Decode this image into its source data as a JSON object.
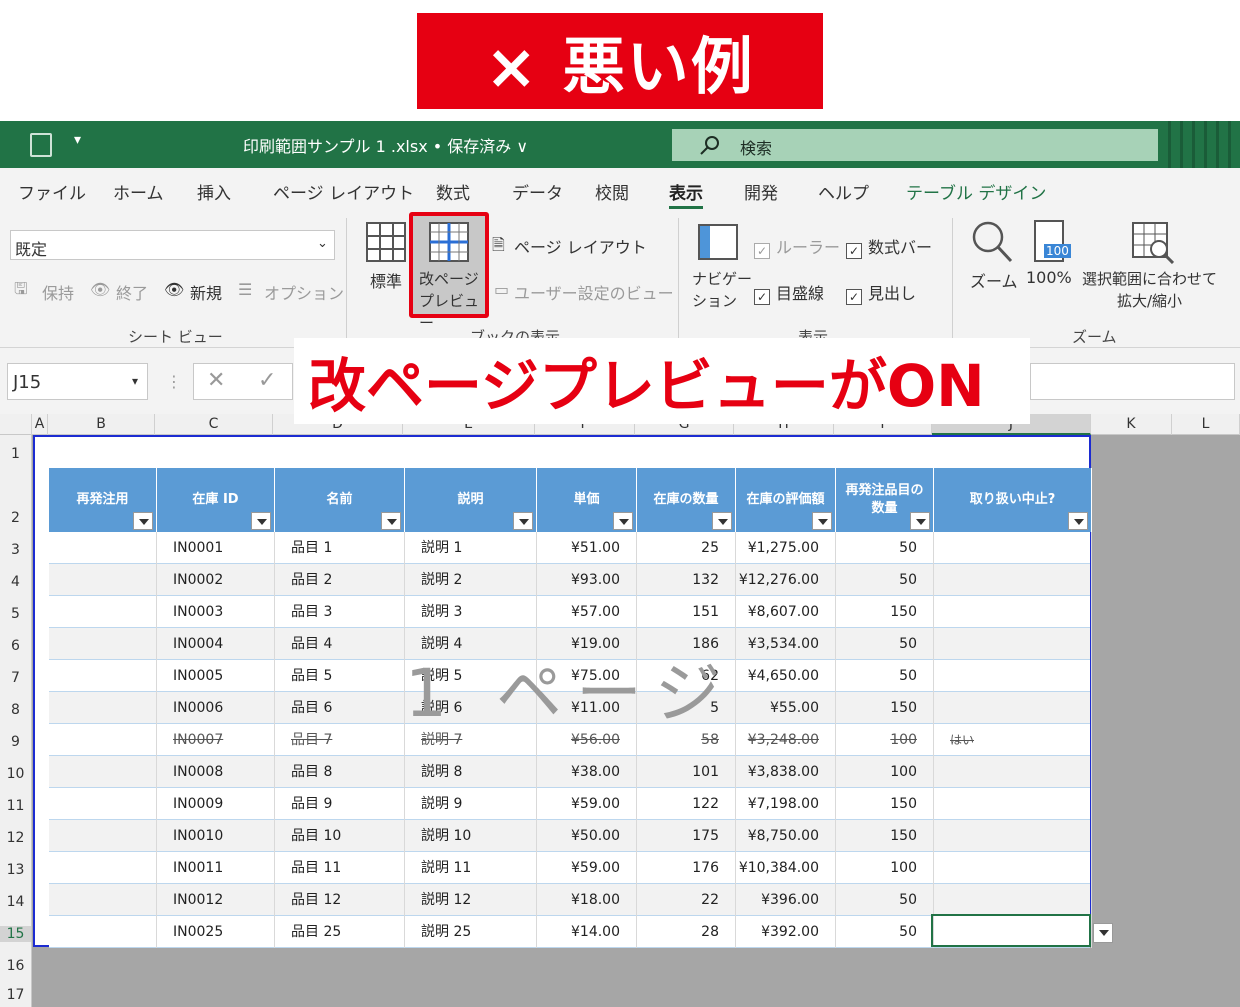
{
  "banner": "× 悪い例",
  "callout": "改ページプレビューがON",
  "title_bar": {
    "filename": "印刷範囲サンプル 1 .xlsx • 保存済み ∨",
    "search_label": "検索"
  },
  "menu": [
    "ファイル",
    "ホーム",
    "挿入",
    "ページ レイアウト",
    "数式",
    "データ",
    "校閲",
    "表示",
    "開発",
    "ヘルプ",
    "テーブル デザイン"
  ],
  "ribbon": {
    "sheet_view": {
      "dropdown": "既定",
      "keep": "保持",
      "exit": "終了",
      "new": "新規",
      "options": "オプション",
      "group": "シート ビュー"
    },
    "book_view": {
      "normal": "標準",
      "page_break": "改ページ\nプレビュー",
      "page_layout": "ページ レイアウト",
      "custom": "ユーザー設定のビュー",
      "group": "ブックの表示"
    },
    "show": {
      "navigation": "ナビゲー\nション",
      "ruler": "ルーラー",
      "formula_bar": "数式バー",
      "gridlines": "目盛線",
      "headings": "見出し",
      "group": "表示"
    },
    "zoom": {
      "zoom": "ズーム",
      "hundred": "100%",
      "fit": "選択範囲に合わせて\n拡大/縮小",
      "group": "ズーム",
      "icon_text": "100"
    }
  },
  "name_box": "J15",
  "column_letters": [
    "A",
    "B",
    "C",
    "D",
    "E",
    "F",
    "G",
    "H",
    "I",
    "J",
    "K",
    "L"
  ],
  "row_numbers": [
    "1",
    "2",
    "3",
    "4",
    "5",
    "6",
    "7",
    "8",
    "9",
    "10",
    "11",
    "12",
    "13",
    "14",
    "15",
    "16",
    "17"
  ],
  "table_headers": [
    "再発注用",
    "在庫 ID",
    "名前",
    "説明",
    "単価",
    "在庫の数量",
    "在庫の評価額",
    "再発注品目の\n数量",
    "取り扱い中止?"
  ],
  "rows": [
    [
      "",
      "IN0001",
      "品目 1",
      "説明 1",
      "¥51.00",
      "25",
      "¥1,275.00",
      "50",
      ""
    ],
    [
      "",
      "IN0002",
      "品目 2",
      "説明 2",
      "¥93.00",
      "132",
      "¥12,276.00",
      "50",
      ""
    ],
    [
      "",
      "IN0003",
      "品目 3",
      "説明 3",
      "¥57.00",
      "151",
      "¥8,607.00",
      "150",
      ""
    ],
    [
      "",
      "IN0004",
      "品目 4",
      "説明 4",
      "¥19.00",
      "186",
      "¥3,534.00",
      "50",
      ""
    ],
    [
      "",
      "IN0005",
      "品目 5",
      "説明 5",
      "¥75.00",
      "62",
      "¥4,650.00",
      "50",
      ""
    ],
    [
      "",
      "IN0006",
      "品目 6",
      "説明 6",
      "¥11.00",
      "5",
      "¥55.00",
      "150",
      ""
    ],
    [
      "",
      "IN0007",
      "品目 7",
      "説明 7",
      "¥56.00",
      "58",
      "¥3,248.00",
      "100",
      "はい"
    ],
    [
      "",
      "IN0008",
      "品目 8",
      "説明 8",
      "¥38.00",
      "101",
      "¥3,838.00",
      "100",
      ""
    ],
    [
      "",
      "IN0009",
      "品目 9",
      "説明 9",
      "¥59.00",
      "122",
      "¥7,198.00",
      "150",
      ""
    ],
    [
      "",
      "IN0010",
      "品目 10",
      "説明 10",
      "¥50.00",
      "175",
      "¥8,750.00",
      "150",
      ""
    ],
    [
      "",
      "IN0011",
      "品目 11",
      "説明 11",
      "¥59.00",
      "176",
      "¥10,384.00",
      "100",
      ""
    ],
    [
      "",
      "IN0012",
      "品目 12",
      "説明 12",
      "¥18.00",
      "22",
      "¥396.00",
      "50",
      ""
    ],
    [
      "",
      "IN0025",
      "品目 25",
      "説明 25",
      "¥14.00",
      "28",
      "¥392.00",
      "50",
      ""
    ]
  ],
  "strike_row_index": 6,
  "watermark": "1 ページ",
  "colors": {
    "excel_green": "#217346",
    "banner_red": "#e60012",
    "header_blue": "#5b9bd5",
    "page_border": "#1c2bd1",
    "outside_gray": "#a6a6a6"
  }
}
